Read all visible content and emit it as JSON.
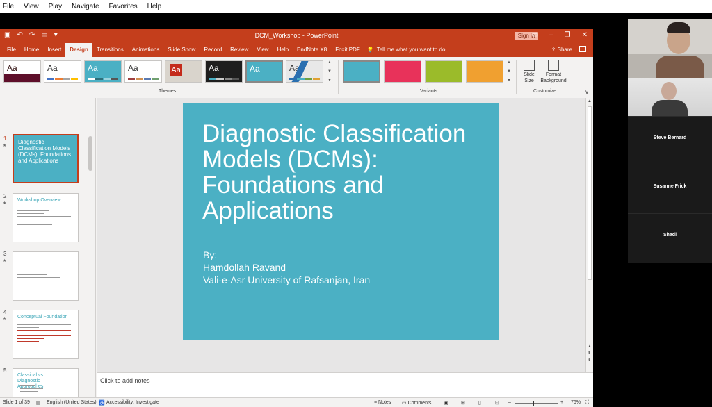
{
  "outer_menu": [
    "File",
    "View",
    "Play",
    "Navigate",
    "Favorites",
    "Help"
  ],
  "titlebar": {
    "title": "DCM_Workshop  -  PowerPoint",
    "signin": "Sign in"
  },
  "tabs": [
    "File",
    "Home",
    "Insert",
    "Design",
    "Transitions",
    "Animations",
    "Slide Show",
    "Record",
    "Review",
    "View",
    "Help",
    "EndNote X8",
    "Foxit PDF"
  ],
  "active_tab": "Design",
  "tell_me": "Tell me what you want to do",
  "share": "Share",
  "ribbon": {
    "theme_label": "Aa",
    "themes_group": "Themes",
    "variants_group": "Variants",
    "customize_group": "Customize",
    "slide_size": "Slide Size",
    "format_background": "Format Background",
    "theme_colors": [
      "#ffffff",
      "#ffffff",
      "#4bb0c4",
      "#ffffff",
      "#d9d4cc",
      "#c42b1c",
      "#1e1e1e",
      "#4bb0c4",
      "#e8e8e8"
    ],
    "variant_colors": [
      "#4bb0c4",
      "#e8325a",
      "#9bbb2a",
      "#f0a030"
    ]
  },
  "thumbnails": [
    {
      "num": "1",
      "title": "Diagnostic Classification Models (DCMs): Foundations and Applications"
    },
    {
      "num": "2",
      "title": "Workshop Overview"
    },
    {
      "num": "3",
      "title": ""
    },
    {
      "num": "4",
      "title": "Conceptual Foundation"
    },
    {
      "num": "5",
      "title": "Classical vs. Diagnostic Approaches"
    }
  ],
  "slide": {
    "title": "Diagnostic Classification Models (DCMs): Foundations and Applications",
    "by": "By:",
    "author": "Hamdollah Ravand",
    "affiliation": "Vali-e-Asr University of Rafsanjan, Iran"
  },
  "notes_placeholder": "Click to add notes",
  "status": {
    "slide_count": "Slide 1 of 39",
    "language": "English (United States)",
    "accessibility": "Accessibility: Investigate",
    "notes": "Notes",
    "comments": "Comments",
    "zoom": "76%"
  },
  "participants": [
    "Steve Bernard",
    "Susanne Frick",
    "Shadi"
  ]
}
